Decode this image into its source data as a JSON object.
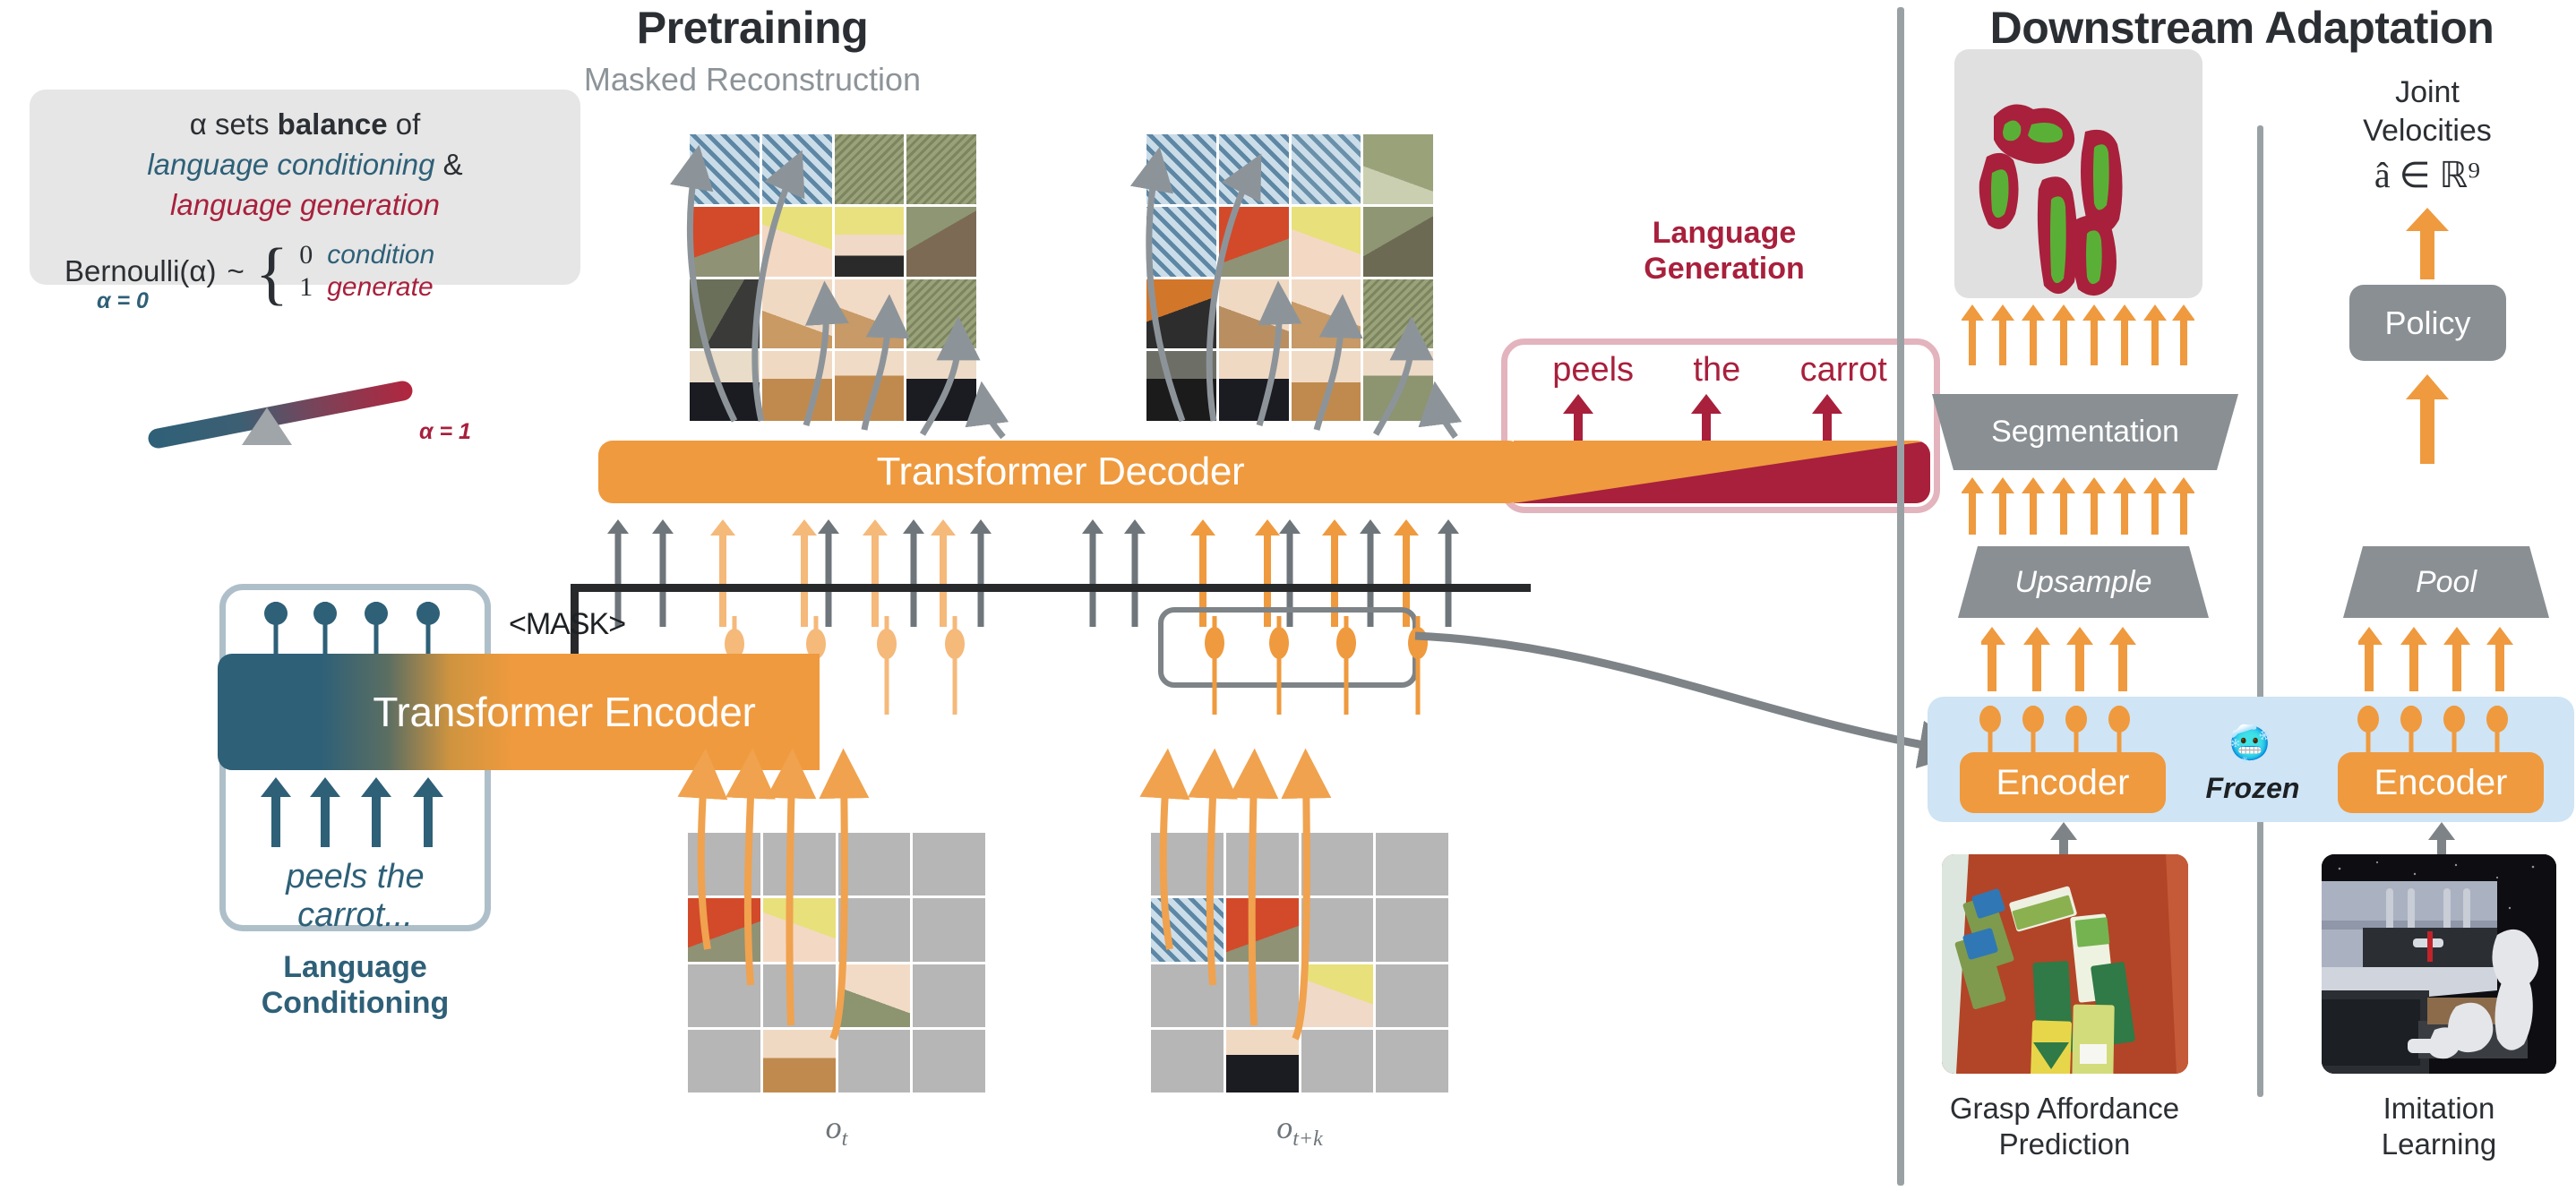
{
  "pretraining": {
    "title": "Pretraining",
    "subtitle": "Masked Reconstruction",
    "alpha_card": {
      "line1_pre": "α sets ",
      "line1_bold": "balance",
      "line1_post": " of",
      "line2_italic": "language conditioning",
      "line2_amp": " &",
      "line3_italic": "language generation",
      "bernoulli": "Bernoulli(α)",
      "tilde": "~",
      "case0_num": "0",
      "case0_word": "condition",
      "case1_num": "1",
      "case1_word": "generate",
      "alpha_zero": "α = 0",
      "alpha_one": "α = 1"
    },
    "decoder_label": "Transformer Decoder",
    "encoder_label": "Transformer Encoder",
    "mask_token": "<MASK>",
    "language_conditioning": {
      "text": "peels the\ncarrot...",
      "caption": "Language\nConditioning"
    },
    "language_generation": {
      "caption": "Language\nGeneration",
      "words": [
        "peels",
        "the",
        "carrot"
      ]
    },
    "observations": [
      {
        "label": "o",
        "sub": "t"
      },
      {
        "label": "o",
        "sub": "t+k"
      }
    ]
  },
  "downstream": {
    "title": "Downstream Adaptation",
    "left": {
      "segmentation_label": "Segmentation",
      "upsample_label": "Upsample",
      "encoder_label": "Encoder",
      "task_caption": "Grasp Affordance\nPrediction"
    },
    "right": {
      "output_label": "Joint\nVelocities",
      "output_expr": "â ∈ ℝ⁹",
      "policy_label": "Policy",
      "pool_label": "Pool",
      "encoder_label": "Encoder",
      "task_caption": "Imitation\nLearning"
    },
    "frozen": {
      "label": "Frozen",
      "icon": "🥶"
    }
  },
  "colors": {
    "orange": "#EF9A3E",
    "teal": "#2E6078",
    "crimson": "#A8203C",
    "gray_box": "#E6E6E6",
    "frozen_blue": "#CFE4F5",
    "trapezoid_gray": "#8A8F93",
    "patch_gray": "#B6B6B6"
  }
}
